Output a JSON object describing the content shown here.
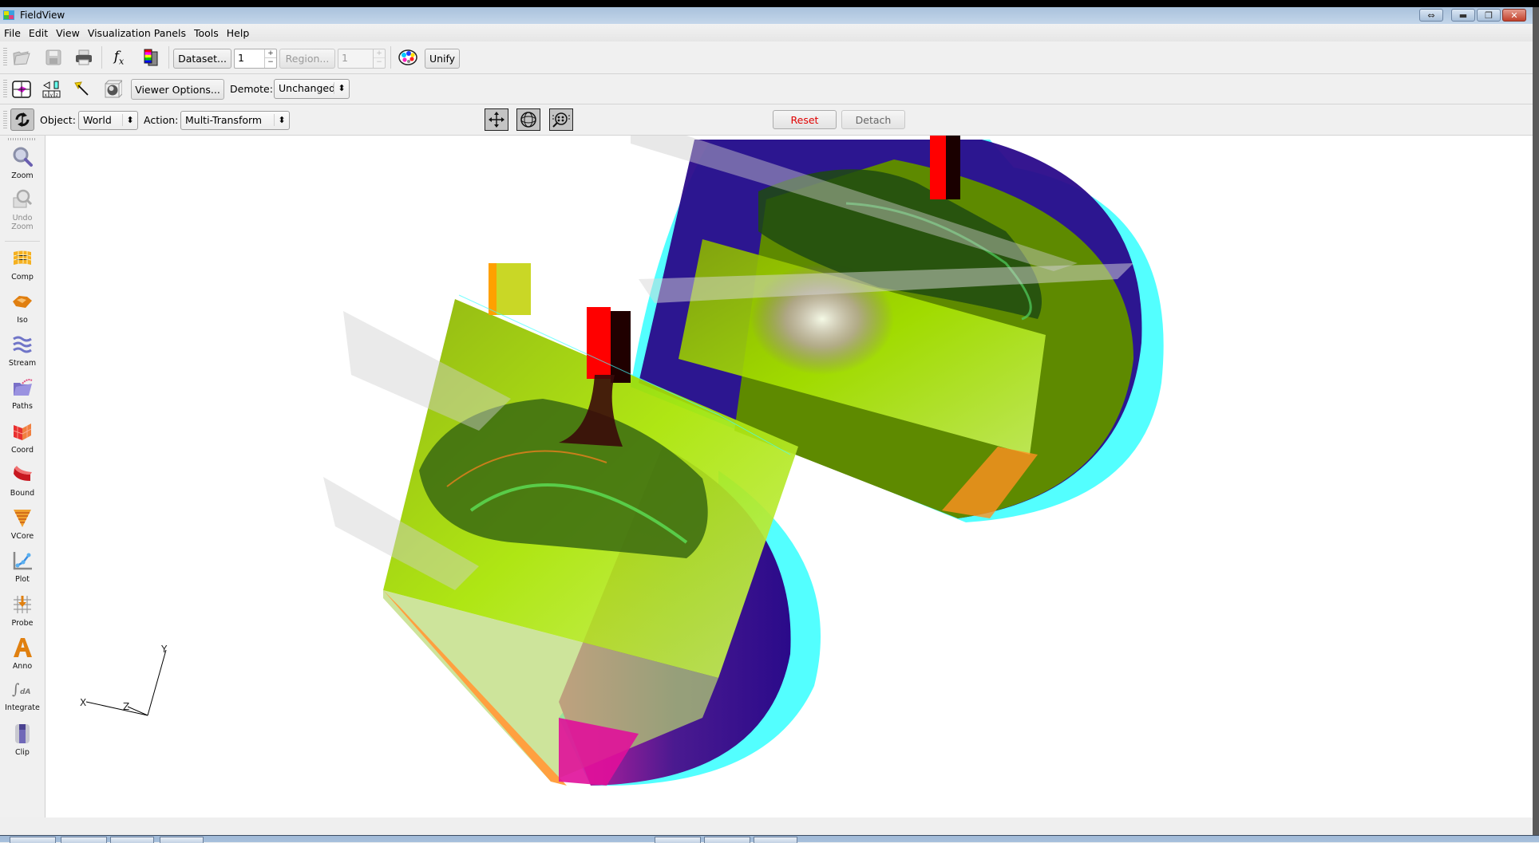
{
  "window": {
    "title": "FieldView",
    "app_icon": "fieldview-logo-icon",
    "controls": [
      "resize-icon",
      "minimize-icon",
      "restore-icon",
      "close-icon"
    ]
  },
  "menubar": {
    "items": [
      "File",
      "Edit",
      "View",
      "Visualization Panels",
      "Tools",
      "Help"
    ]
  },
  "toolbar1": {
    "icons": [
      "open-folder-icon",
      "save-icon",
      "print-icon",
      "function-fx-icon",
      "colormap-icon"
    ],
    "dataset_label": "Dataset...",
    "dataset_value": "1",
    "region_label": "Region...",
    "region_value": "1",
    "palette_icon": "color-palette-icon",
    "unify_label": "Unify"
  },
  "toolbar2": {
    "icons": [
      "fit-view-icon",
      "coordinate-xyz-icon",
      "pick-cursor-icon",
      "sphere-box-icon"
    ],
    "viewer_options_label": "Viewer Options...",
    "demote_label": "Demote:",
    "demote_value": "Unchanged"
  },
  "toolbar3": {
    "mode_icon": "transform-rotate-icon",
    "object_label": "Object:",
    "object_value": "World",
    "action_label": "Action:",
    "action_value": "Multi-Transform",
    "view_icons": [
      "translate-arrows-icon",
      "rotate-globe-icon",
      "zoom-globe-icon"
    ],
    "reset_label": "Reset",
    "detach_label": "Detach",
    "reset_color": "#e00000"
  },
  "sidebar": {
    "items": [
      {
        "label": "Zoom",
        "icon": "zoom-magnifier-icon",
        "enabled": true
      },
      {
        "label": "Undo Zoom",
        "icon": "undo-zoom-icon",
        "enabled": false
      },
      {
        "label": "Comp",
        "icon": "computational-surface-icon",
        "enabled": true
      },
      {
        "label": "Iso",
        "icon": "iso-surface-icon",
        "enabled": true
      },
      {
        "label": "Stream",
        "icon": "streamlines-icon",
        "enabled": true
      },
      {
        "label": "Paths",
        "icon": "particle-paths-icon",
        "enabled": true
      },
      {
        "label": "Coord",
        "icon": "coordinate-surface-icon",
        "enabled": true
      },
      {
        "label": "Bound",
        "icon": "boundary-surface-icon",
        "enabled": true
      },
      {
        "label": "VCore",
        "icon": "vortex-core-icon",
        "enabled": true
      },
      {
        "label": "Plot",
        "icon": "plot-icon",
        "enabled": true
      },
      {
        "label": "Probe",
        "icon": "probe-icon",
        "enabled": true
      },
      {
        "label": "Anno",
        "icon": "annotation-icon",
        "enabled": true
      },
      {
        "label": "Integrate",
        "icon": "integrate-icon",
        "enabled": true
      },
      {
        "label": "Clip",
        "icon": "clip-icon",
        "enabled": true
      }
    ]
  },
  "viewport": {
    "description": "3D stereo anaglyph render of two mixing vessels with streamlines",
    "axes": {
      "x": "X",
      "y": "Y",
      "z": "Z"
    },
    "colors": {
      "cyan": "#00ffff",
      "magenta": "#e0109a",
      "indigo": "#2a0a8a",
      "lime": "#a6e000",
      "olive": "#5e8a00",
      "orange": "#ffa040",
      "red": "#ff0000"
    }
  }
}
